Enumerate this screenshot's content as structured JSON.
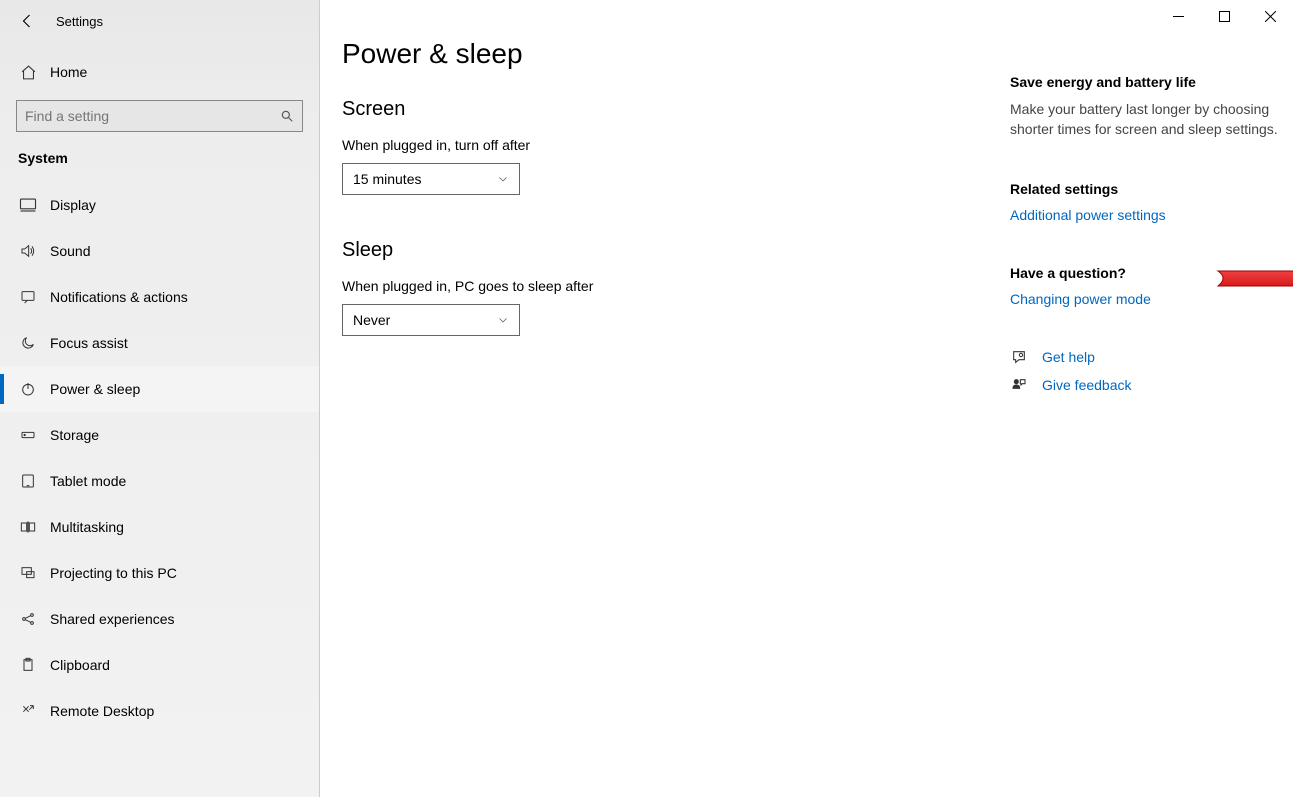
{
  "header": {
    "title": "Settings"
  },
  "home_label": "Home",
  "search": {
    "placeholder": "Find a setting"
  },
  "section_label": "System",
  "nav": [
    {
      "label": "Display"
    },
    {
      "label": "Sound"
    },
    {
      "label": "Notifications & actions"
    },
    {
      "label": "Focus assist"
    },
    {
      "label": "Power & sleep"
    },
    {
      "label": "Storage"
    },
    {
      "label": "Tablet mode"
    },
    {
      "label": "Multitasking"
    },
    {
      "label": "Projecting to this PC"
    },
    {
      "label": "Shared experiences"
    },
    {
      "label": "Clipboard"
    },
    {
      "label": "Remote Desktop"
    }
  ],
  "page": {
    "title": "Power & sleep",
    "screen_heading": "Screen",
    "screen_label": "When plugged in, turn off after",
    "screen_value": "15 minutes",
    "sleep_heading": "Sleep",
    "sleep_label": "When plugged in, PC goes to sleep after",
    "sleep_value": "Never"
  },
  "right": {
    "energy_heading": "Save energy and battery life",
    "energy_text": "Make your battery last longer by choosing shorter times for screen and sleep settings.",
    "related_heading": "Related settings",
    "related_link": "Additional power settings",
    "question_heading": "Have a question?",
    "question_link": "Changing power mode",
    "get_help": "Get help",
    "give_feedback": "Give feedback"
  }
}
